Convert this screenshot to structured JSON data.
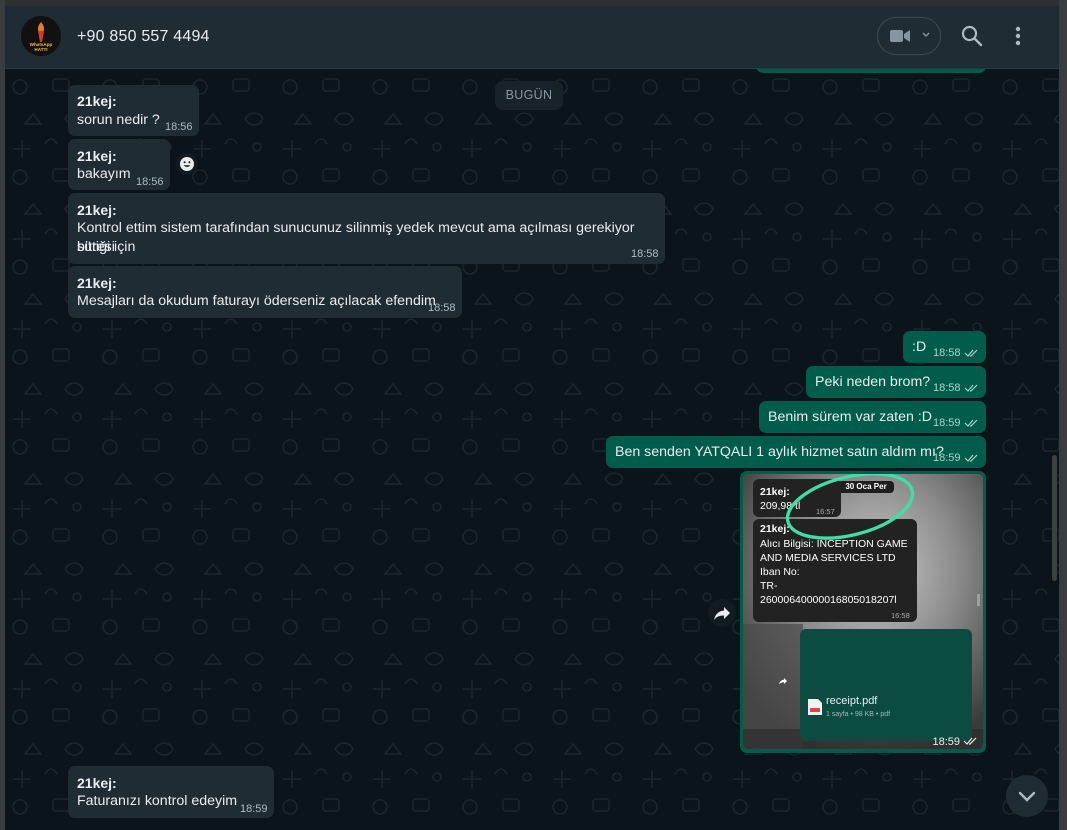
{
  "header": {
    "contact_name": "+90 850 557 4494",
    "avatar_text_line1": "WhatsApp",
    "avatar_text_line2": "HATTI"
  },
  "date_chip": "BUGÜN",
  "messages": [
    {
      "sender": "21kej:",
      "text": "sorun nedir ?",
      "time": "18:56"
    },
    {
      "sender": "21kej:",
      "text": "bakayım",
      "time": "18:56"
    },
    {
      "sender": "21kej:",
      "text_line1": "Kontrol ettim sistem tarafından sunucunuz silinmiş yedek mevcut ama açılması gerekiyor süresi",
      "text_line2": "bittiği için",
      "time": "18:58"
    },
    {
      "sender": "21kej:",
      "text": "Mesajları da okudum faturayı öderseniz açılacak efendim",
      "time": "18:58"
    },
    {
      "text": ":D",
      "time": "18:58"
    },
    {
      "text": "Peki neden brom?",
      "time": "18:58"
    },
    {
      "text": "Benim sürem var zaten :D",
      "time": "18:59"
    },
    {
      "text": "Ben senden YATQALI 1 aylık hizmet satın aldım mı?",
      "time": "18:59"
    },
    {
      "sender": "21kej:",
      "text": "Faturanızı kontrol edeyim",
      "time": "18:59"
    }
  ],
  "image_message": {
    "time": "18:59",
    "inner_date": "30 Oca Per",
    "inner_bubble1": {
      "sender": "21kej:",
      "text": "209,98 tl",
      "time": "16:57"
    },
    "inner_bubble2": {
      "sender": "21kej:",
      "lines": [
        "Alıcı Bilgisi: INCEPTION GAME",
        "AND MEDIA SERVICES LTD",
        "Iban No:",
        "TR-",
        "26000640000016805018207l"
      ],
      "time": "16:58"
    },
    "pdf": {
      "name": "receipt.pdf",
      "meta": "1 sayfa • 98 KB • pdf"
    }
  },
  "colors": {
    "incoming": "#202c33",
    "outgoing": "#005c4b",
    "background": "#0b141a",
    "highlight_circle": "#3be0a5"
  }
}
